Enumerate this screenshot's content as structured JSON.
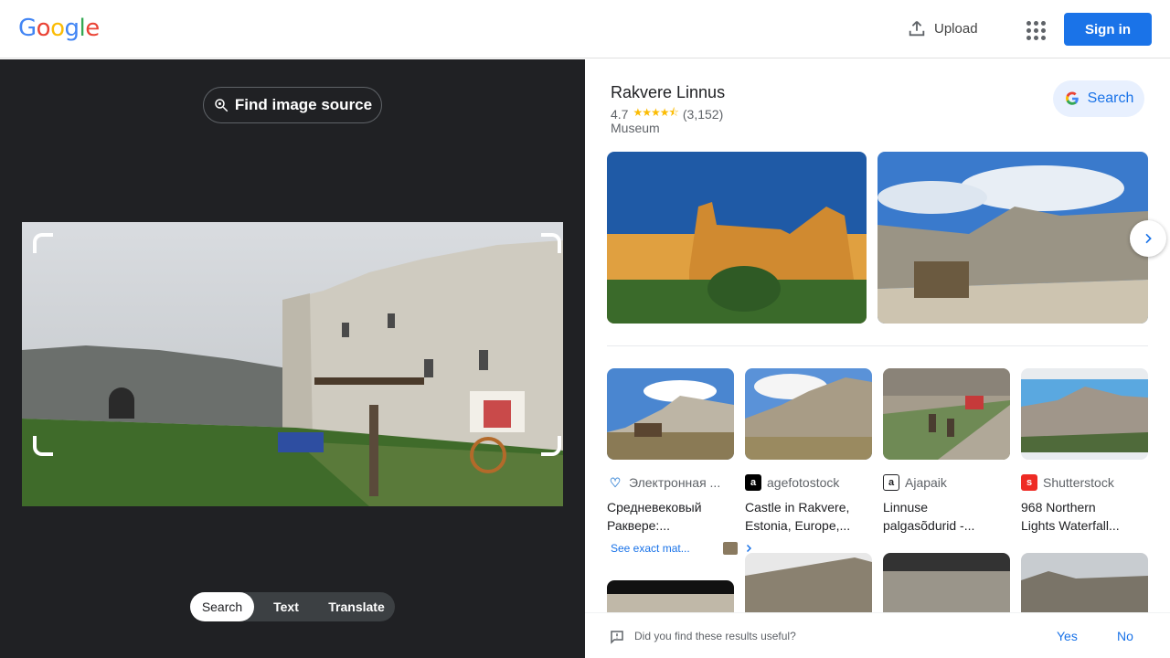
{
  "header": {
    "logo_letters": [
      "G",
      "o",
      "o",
      "g",
      "l",
      "e"
    ],
    "upload_label": "Upload",
    "signin_label": "Sign in",
    "colors": {
      "blue": "#4285f4",
      "red": "#ea4335",
      "yellow": "#fbbc05",
      "green": "#34a853",
      "signin_bg": "#1a73e8"
    }
  },
  "left_panel": {
    "find_source_label": "Find image source",
    "modes": [
      "Search",
      "Text",
      "Translate"
    ],
    "active_mode": "Search"
  },
  "entity": {
    "title": "Rakvere Linnus",
    "rating": "4.7",
    "stars": "★★★★⯪",
    "review_count": "(3,152)",
    "category": "Museum",
    "search_button_label": "Search"
  },
  "results": [
    {
      "source": "Электронная ...",
      "title_line1": "Средневековый",
      "title_line2": "Раквере:...",
      "icon": "wave-icon",
      "icon_color": "#4a90d9"
    },
    {
      "source": "agefotostock",
      "title_line1": "Castle in Rakvere,",
      "title_line2": "Estonia, Europe,...",
      "icon": "age-icon",
      "icon_color": "#000000"
    },
    {
      "source": "Ajapaik",
      "title_line1": "Linnuse",
      "title_line2": "palgasõdurid -...",
      "icon": "ajapaik-icon",
      "icon_color": "#202124"
    },
    {
      "source": "Shutterstock",
      "title_line1": "968 Northern",
      "title_line2": "Lights Waterfall...",
      "icon": "shutterstock-icon",
      "icon_color": "#ee2b24"
    }
  ],
  "exact_matches_label": "See exact mat...",
  "feedback": {
    "question": "Did you find these results useful?",
    "yes": "Yes",
    "no": "No"
  }
}
